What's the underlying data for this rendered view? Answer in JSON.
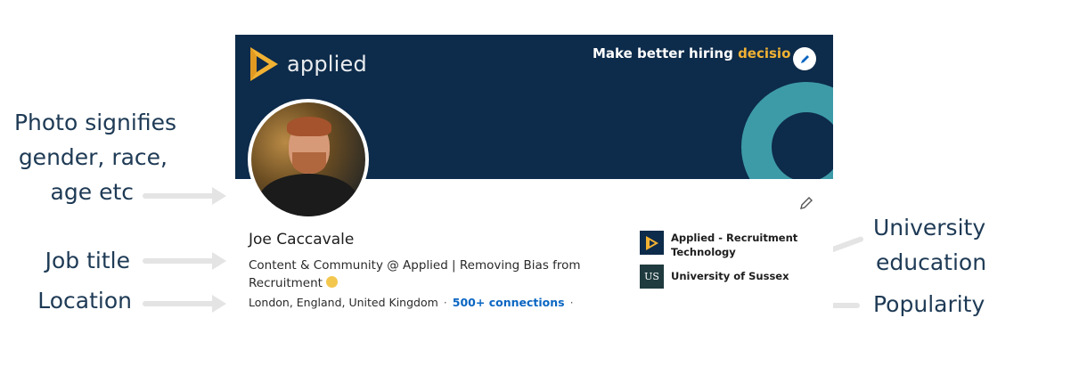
{
  "annotations": {
    "photo": [
      "Photo signifies",
      "gender, race,",
      "age etc"
    ],
    "job_title": "Job title",
    "location": "Location",
    "university": [
      "University",
      "education"
    ],
    "popularity": "Popularity"
  },
  "banner": {
    "logo_text": "applied",
    "tagline_main": "Make better hiring ",
    "tagline_accent": "decisio"
  },
  "profile": {
    "name": "Joe Caccavale",
    "headline": "Content & Community @ Applied | Removing Bias from Recruitment",
    "location": "London, England, United Kingdom",
    "separator": "·",
    "connections": "500+ connections"
  },
  "experience": [
    {
      "logo": "applied-play-logo",
      "label": "Applied - Recruitment Technology"
    },
    {
      "logo": "us-logo",
      "logo_text": "US",
      "label": "University of Sussex"
    }
  ],
  "colors": {
    "banner_bg": "#0d2b4a",
    "accent_gold": "#f1b233",
    "ring_teal": "#3d9ba8",
    "link_blue": "#0a66c2",
    "annotation_text": "#1e3a55"
  }
}
